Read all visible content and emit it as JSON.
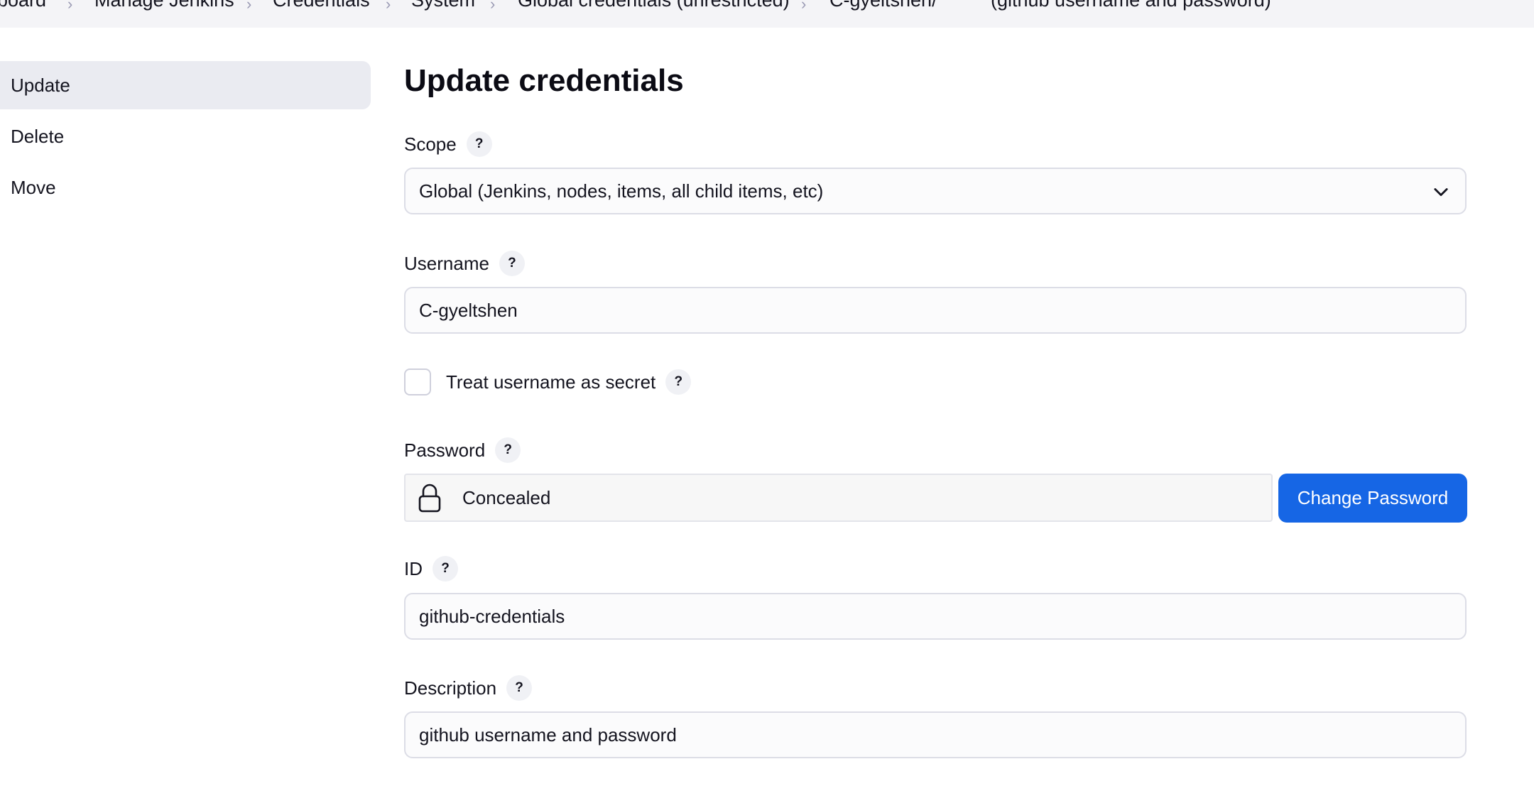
{
  "breadcrumb": [
    {
      "label": "board"
    },
    {
      "label": "Manage Jenkins"
    },
    {
      "label": "Credentials"
    },
    {
      "label": "System"
    },
    {
      "label": "Global credentials (unrestricted)"
    },
    {
      "label": "C-gyeltshen/"
    },
    {
      "label": "(github username and password)"
    }
  ],
  "sidebar": {
    "items": [
      {
        "label": "Update",
        "active": true
      },
      {
        "label": "Delete",
        "active": false
      },
      {
        "label": "Move",
        "active": false
      }
    ]
  },
  "main": {
    "title": "Update credentials",
    "help_glyph": "?",
    "scope": {
      "label": "Scope",
      "value": "Global (Jenkins, nodes, items, all child items, etc)",
      "icon": "chevron-down-icon"
    },
    "username": {
      "label": "Username",
      "value": "C-gyeltshen"
    },
    "treat_secret": {
      "label": "Treat username as secret",
      "checked": false
    },
    "password": {
      "label": "Password",
      "value": "Concealed",
      "icon": "lock-icon",
      "button": "Change Password"
    },
    "id": {
      "label": "ID",
      "value": "github-credentials"
    },
    "description": {
      "label": "Description",
      "value": "github username and password"
    }
  },
  "colors": {
    "accent": "#1666e5",
    "breadcrumb_bg": "#f4f4f7",
    "sidebar_active_bg": "#eaebf1"
  }
}
